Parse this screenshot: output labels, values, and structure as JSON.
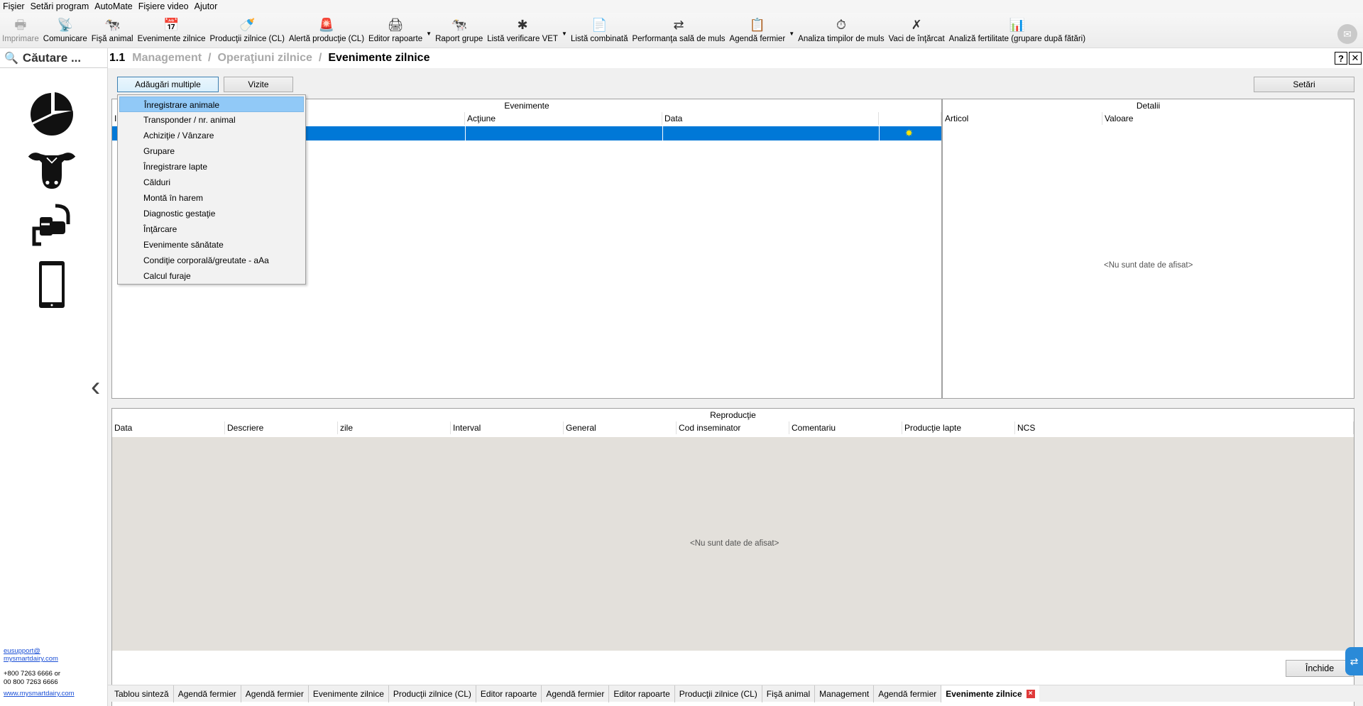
{
  "menu": [
    "Fişier",
    "Setări program",
    "AutoMate",
    "Fişiere video",
    "Ajutor"
  ],
  "toolbar": [
    {
      "label": "Imprimare",
      "icon": "printer-icon",
      "glyph": "🖶",
      "disabled": true
    },
    {
      "label": "Comunicare",
      "icon": "antenna-icon",
      "glyph": "📡"
    },
    {
      "label": "Fişă animal",
      "icon": "cows-icon",
      "glyph": "🐄"
    },
    {
      "label": "Evenimente zilnice",
      "icon": "calendar-icon",
      "glyph": "📅"
    },
    {
      "label": "Producţii zilnice (CL)",
      "icon": "milk-bottle-icon",
      "glyph": "🍼"
    },
    {
      "label": "Alertă producţie (CL)",
      "icon": "alert-bottle-icon",
      "glyph": "🚨"
    },
    {
      "label": "Editor rapoarte",
      "icon": "report-printer-icon",
      "glyph": "🖨",
      "caret": true
    },
    {
      "label": "Raport grupe",
      "icon": "group-icon",
      "glyph": "🐄"
    },
    {
      "label": "Listă verificare VET",
      "icon": "vet-icon",
      "glyph": "✱",
      "caret": true
    },
    {
      "label": "Listă combinată",
      "icon": "list-icon",
      "glyph": "📄"
    },
    {
      "label": "Performanţa sală de muls",
      "icon": "parlour-icon",
      "glyph": "⇄"
    },
    {
      "label": "Agendă fermier",
      "icon": "agenda-icon",
      "glyph": "📋",
      "caret": true
    },
    {
      "label": "Analiza timpilor de muls",
      "icon": "timer-icon",
      "glyph": "⏱"
    },
    {
      "label": "Vaci de înţărcat",
      "icon": "dry-cow-icon",
      "glyph": "✗"
    },
    {
      "label": "Analiză fertilitate (grupare după fătări)",
      "icon": "fertility-chart-icon",
      "glyph": "📊"
    }
  ],
  "search": {
    "label": "Căutare ..."
  },
  "header": {
    "num": "1.1",
    "crumb1": "Management",
    "crumb2": "Operaţiuni zilnice",
    "current": "Evenimente zilnice"
  },
  "buttons": {
    "multi": "Adăugări multiple",
    "visits": "Vizite",
    "settings": "Setări",
    "close": "Închide"
  },
  "events": {
    "title": "Evenimente",
    "columns": [
      "Acţiune",
      "Data"
    ]
  },
  "details": {
    "title": "Detalii",
    "columns": [
      "Articol",
      "Valoare"
    ],
    "empty": "<Nu sunt date de afisat>"
  },
  "repro": {
    "title": "Reproducţie",
    "columns": [
      "Data",
      "Descriere",
      "zile",
      "Interval",
      "General",
      "Cod inseminator",
      "Comentariu",
      "Producţie lapte",
      "NCS"
    ],
    "empty": "<Nu sunt date de afisat>"
  },
  "dropdown": [
    "Înregistrare animale",
    "Transponder / nr. animal",
    "Achiziţie / Vânzare",
    "Grupare",
    "Înregistrare lapte",
    "Călduri",
    "Montă în harem",
    "Diagnostic gestaţie",
    "Înţărcare",
    "Evenimente sănătate",
    "Condiţie corporală/greutate - aAa",
    "Calcul furaje"
  ],
  "contact": {
    "email1": "eusupport@",
    "email2": "mysmartdairy.com",
    "phone1": "+800 7263 6666 or",
    "phone2": "00 800 7263 6666",
    "web": "www.mysmartdairy.com"
  },
  "tabs": [
    "Tablou sinteză",
    "Agendă fermier",
    "Agendă fermier",
    "Evenimente zilnice",
    "Producţii zilnice (CL)",
    "Editor rapoarte",
    "Agendă fermier",
    "Editor rapoarte",
    "Producţii zilnice (CL)",
    "Fişă animal",
    "Management",
    "Agendă fermier",
    "Evenimente zilnice"
  ],
  "colors": {
    "selection": "#0078d7",
    "highlight": "#91c9f7"
  }
}
